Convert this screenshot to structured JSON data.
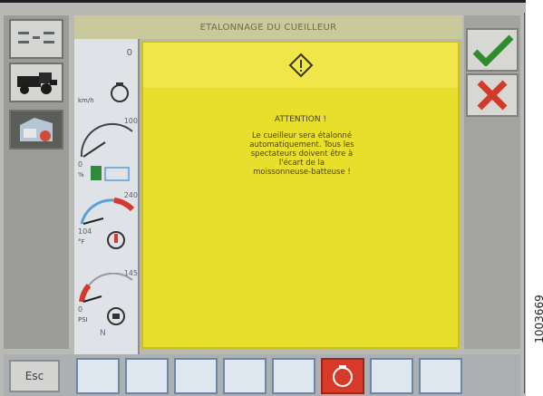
{
  "header": {
    "title": "ETALONNAGE DU CUEILLEUR"
  },
  "dialog": {
    "title": "ATTENTION !",
    "lines": [
      "Le cueilleur sera étalonné",
      "automatiquement. Tous les",
      "spectateurs doivent être à",
      "l'écart de la",
      "moissonneuse-batteuse !"
    ]
  },
  "gauges": {
    "top_value": "0",
    "top_unit": "km/h",
    "fuel_max": "100",
    "fuel_min": "0",
    "fuel_unit": "%",
    "temp_max": "240",
    "temp_min": "104",
    "temp_unit": "°F",
    "pressure_max": "145",
    "pressure_min": "0",
    "pressure_unit": "PSI",
    "gear": "N"
  },
  "bottom": {
    "esc_label": "Esc"
  },
  "side_id": "1003669",
  "colors": {
    "dialog_bg": "#e8df2c",
    "confirm": "#2e8b2e",
    "cancel": "#d23a2a",
    "active_key": "#d83a2a"
  }
}
